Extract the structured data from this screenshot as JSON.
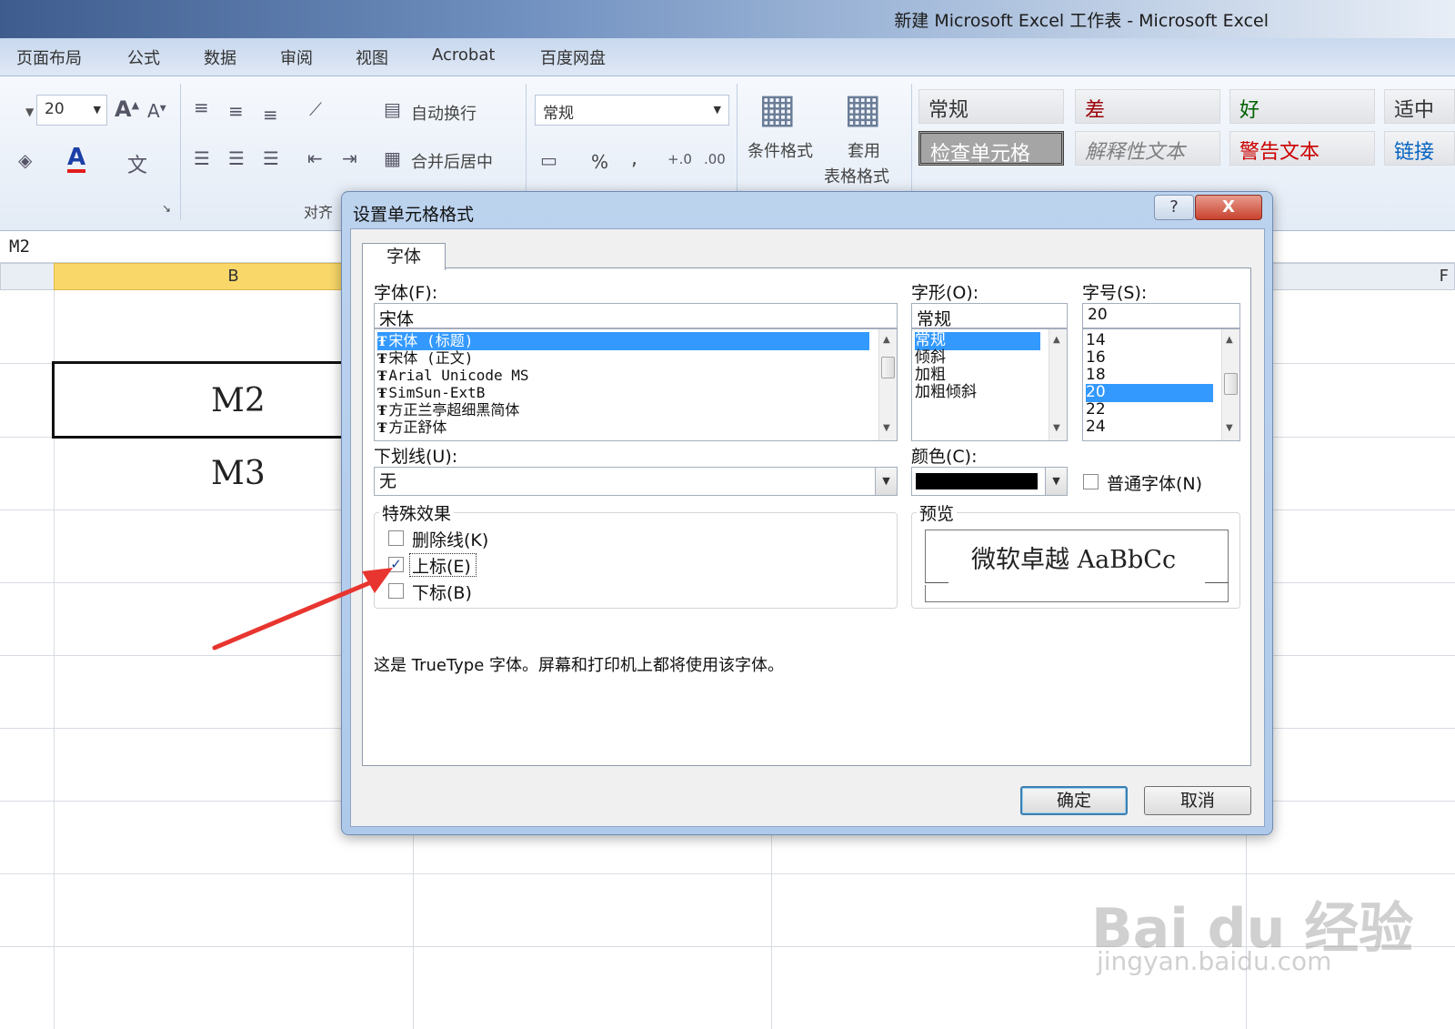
{
  "window": {
    "title": "新建 Microsoft Excel 工作表 - Microsoft Excel"
  },
  "menu": {
    "tabs": [
      "页面布局",
      "公式",
      "数据",
      "审阅",
      "视图",
      "Acrobat",
      "百度网盘"
    ]
  },
  "ribbon": {
    "font_size": "20",
    "wrap_text_label": "自动换行",
    "merge_center_label": "合并后居中",
    "number_format": "常规",
    "align_group_label": "对齐",
    "conditional_format_label": "条件格式",
    "table_format_label_1": "套用",
    "table_format_label_2": "表格格式",
    "percent": "%",
    "comma": ",",
    "styles": [
      "常规",
      "差",
      "好",
      "适中",
      "检查单元格",
      "解释性文本",
      "警告文本",
      "链接"
    ]
  },
  "sheet": {
    "name_box": "M2",
    "col_b": "B",
    "col_f": "F",
    "cells": [
      "M2",
      "M3"
    ]
  },
  "dialog": {
    "title": "设置单元格格式",
    "help": "?",
    "close": "X",
    "tab": "字体",
    "font_label": "字体(F):",
    "font_value": "宋体",
    "font_list": [
      "宋体 (标题)",
      "宋体 (正文)",
      "Arial Unicode MS",
      "SimSun-ExtB",
      "方正兰亭超细黑简体",
      "方正舒体"
    ],
    "style_label": "字形(O):",
    "style_value": "常规",
    "style_list": [
      "常规",
      "倾斜",
      "加粗",
      "加粗倾斜"
    ],
    "size_label": "字号(S):",
    "size_value": "20",
    "size_list": [
      "14",
      "16",
      "18",
      "20",
      "22",
      "24"
    ],
    "underline_label": "下划线(U):",
    "underline_value": "无",
    "color_label": "颜色(C):",
    "color_value": "#000000",
    "normal_font_label": "普通字体(N)",
    "effects_label": "特殊效果",
    "strike_label": "删除线(K)",
    "superscript_label": "上标(E)",
    "subscript_label": "下标(B)",
    "superscript_checked": true,
    "preview_label": "预览",
    "preview_text": "微软卓越  AaBbCc",
    "info_text": "这是 TrueType 字体。屏幕和打印机上都将使用该字体。",
    "ok": "确定",
    "cancel": "取消"
  },
  "annotation": {
    "arrow_color": "#e8352f"
  },
  "watermark": {
    "logo": "Bai du 经验",
    "url": "jingyan.baidu.com"
  }
}
